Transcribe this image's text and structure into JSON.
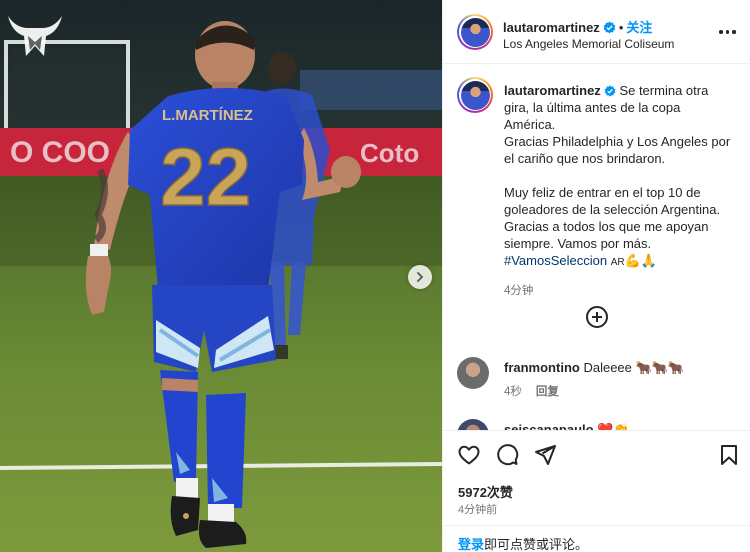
{
  "post": {
    "username": "lautaromartinez",
    "follow_label": "关注",
    "separator": "•",
    "location": "Los Angeles Memorial Coliseum",
    "more_icon": "more-horizontal-icon"
  },
  "photo": {
    "jersey_name": "L.MARTÍNEZ",
    "jersey_number": "22",
    "next_icon": "chevron-right-icon",
    "logo_icon": "bull-logo-icon"
  },
  "caption": {
    "username": "lautaromartinez",
    "text": "Se termina otra gira, la última antes de la copa América.\nGracias Philadelphia y Los Angeles por el cariño que nos brindaron.\n\nMuy feliz de entrar en el top 10 de goleadores de la selección Argentina. Gracias a todos los que me apoyan siempre. Vamos por más. ",
    "hashtag": "#VamosSeleccion",
    "flag_text": "AR",
    "emojis": "💪🙏",
    "time": "4分钟"
  },
  "load_more_icon": "plus-circle-icon",
  "comments": [
    {
      "username": "franmontino",
      "text": "Daleeee",
      "emojis": "🐂🐂🐂",
      "time": "4秒",
      "reply_label": "回复"
    },
    {
      "username": "seiscanapaulo",
      "text": "",
      "emojis": "❤️👏"
    }
  ],
  "actions": {
    "like_icon": "heart-icon",
    "comment_icon": "comment-icon",
    "share_icon": "send-icon",
    "save_icon": "bookmark-icon",
    "likes_text": "5972次赞",
    "time_text": "4分钟前"
  },
  "login": {
    "link_label": "登录",
    "rest_text": "即可点赞或评论。"
  },
  "colors": {
    "accent": "#0095f6",
    "verified": "#0095f6",
    "hashtag": "#00376b",
    "muted": "#737373",
    "jersey": "#2a4ad6",
    "number_gold": "#c9a55a"
  }
}
